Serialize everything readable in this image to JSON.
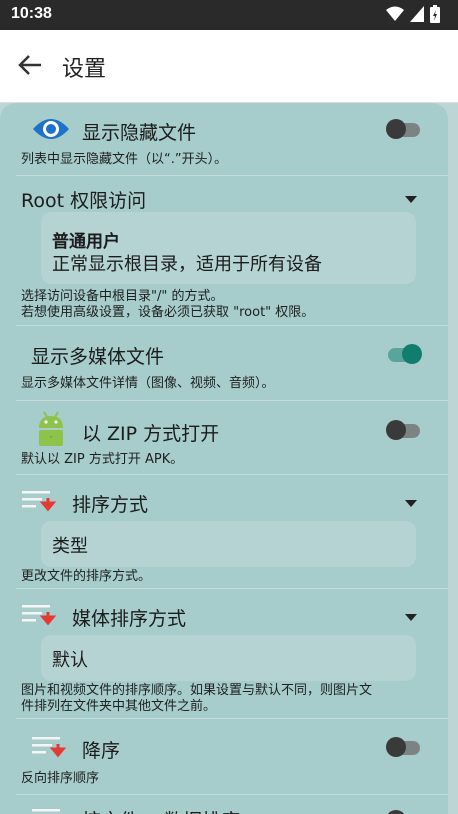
{
  "status_bar": {
    "time": "10:38"
  },
  "app_bar": {
    "title": "设置"
  },
  "settings": {
    "show_hidden": {
      "label": "显示隐藏文件",
      "desc": "列表中显示隐藏文件（以“.”开头）。",
      "enabled": false
    },
    "root_access": {
      "label": "Root 权限访问",
      "selected_title": "普通用户",
      "selected_desc": "正常显示根目录，适用于所有设备",
      "desc_line1": "选择访问设备中根目录\"/\" 的方式。",
      "desc_line2": "若想使用高级设置，设备必须已获取 \"root\" 权限。"
    },
    "show_media": {
      "label": "显示多媒体文件",
      "desc": "显示多媒体文件详情（图像、视频、音频）。",
      "enabled": true
    },
    "zip_open": {
      "label": "以 ZIP 方式打开",
      "desc": "默认以 ZIP 方式打开 APK。",
      "enabled": false
    },
    "sort_mode": {
      "label": "排序方式",
      "value": "类型",
      "desc": "更改文件的排序方式。"
    },
    "media_sort": {
      "label": "媒体排序方式",
      "value": "默认",
      "desc_line1": "图片和视频文件的排序顺序。如果设置与默认不同，则图片文",
      "desc_line2": "件排列在文件夹中其他文件之前。"
    },
    "descending": {
      "label": "降序",
      "desc": "反向排序顺序",
      "enabled": false
    },
    "partial_next": {
      "label": "按文件… 数据排序"
    }
  },
  "colors": {
    "accent": "#117d6f",
    "eye_icon": "#1e73c9",
    "android_icon": "#8dc34a",
    "sort_arrow": "#e53935"
  }
}
